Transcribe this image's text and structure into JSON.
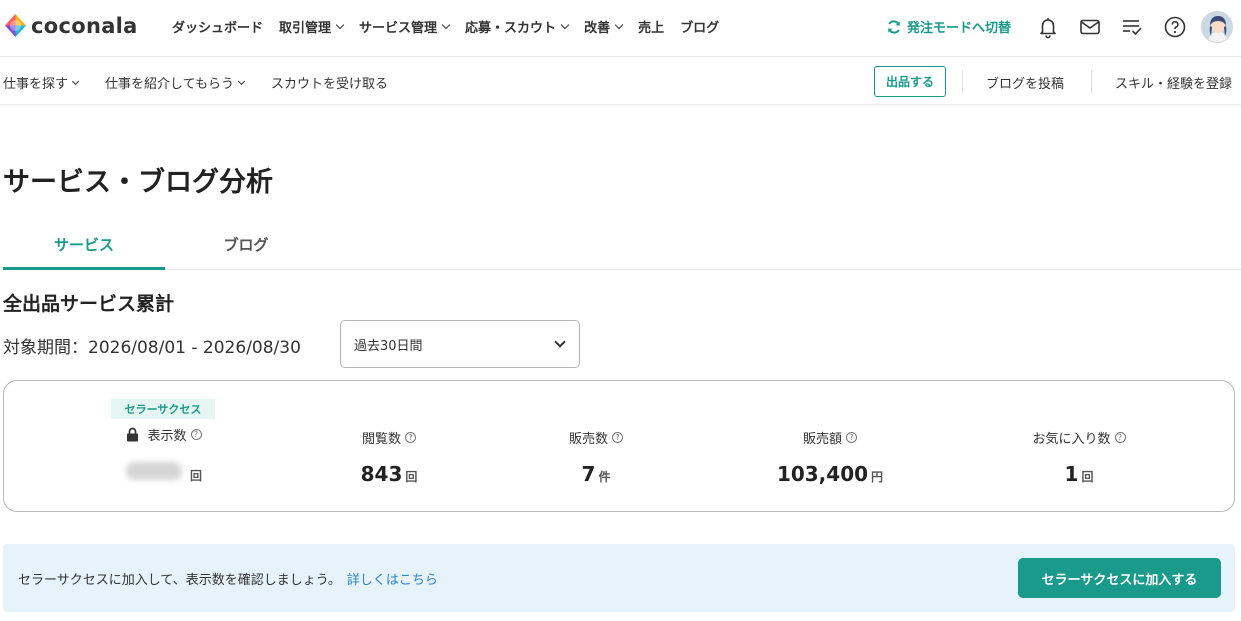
{
  "brand": {
    "name": "coconala",
    "logo_colors": [
      "#ff5a5f",
      "#f5b31b",
      "#2ab0d8",
      "#7a4fd8"
    ]
  },
  "header": {
    "nav": [
      {
        "label": "ダッシュボード",
        "dropdown": false
      },
      {
        "label": "取引管理",
        "dropdown": true
      },
      {
        "label": "サービス管理",
        "dropdown": true
      },
      {
        "label": "応募・スカウト",
        "dropdown": true
      },
      {
        "label": "改善",
        "dropdown": true
      },
      {
        "label": "売上",
        "dropdown": false
      },
      {
        "label": "ブログ",
        "dropdown": false
      }
    ],
    "mode_switch_label": "発注モードへ切替",
    "icons": [
      "bell-icon",
      "mail-icon",
      "checklist-icon",
      "help-icon"
    ]
  },
  "subnav": {
    "items": [
      {
        "label": "仕事を探す",
        "dropdown": true
      },
      {
        "label": "仕事を紹介してもらう",
        "dropdown": true
      },
      {
        "label": "スカウトを受け取る",
        "dropdown": false
      }
    ],
    "listing_button": "出品する",
    "blog_post": "ブログを投稿",
    "register_skill": "スキル・経験を登録"
  },
  "page": {
    "title": "サービス・ブログ分析",
    "tabs": [
      {
        "label": "サービス",
        "active": true
      },
      {
        "label": "ブログ",
        "active": false
      }
    ]
  },
  "summary": {
    "title": "全出品サービス累計",
    "period_label": "対象期間：2026/08/01 - 2026/08/30",
    "period_select": "過去30日間"
  },
  "stats": [
    {
      "badge": "セラーサクセス",
      "label": "表示数",
      "value": "",
      "unit": "回",
      "locked": true
    },
    {
      "label": "閲覧数",
      "value": "843",
      "unit": "回"
    },
    {
      "label": "販売数",
      "value": "7",
      "unit": "件"
    },
    {
      "label": "販売額",
      "value": "103,400",
      "unit": "円"
    },
    {
      "label": "お気に入り数",
      "value": "1",
      "unit": "回"
    }
  ],
  "promo": {
    "text": "セラーサクセスに加入して、表示数を確認しましょう。",
    "link": "詳しくはこちら",
    "button": "セラーサクセスに加入する"
  },
  "colors": {
    "accent": "#1a9a8a",
    "link": "#2d84c8",
    "promo_bg": "#e6f3fb"
  }
}
